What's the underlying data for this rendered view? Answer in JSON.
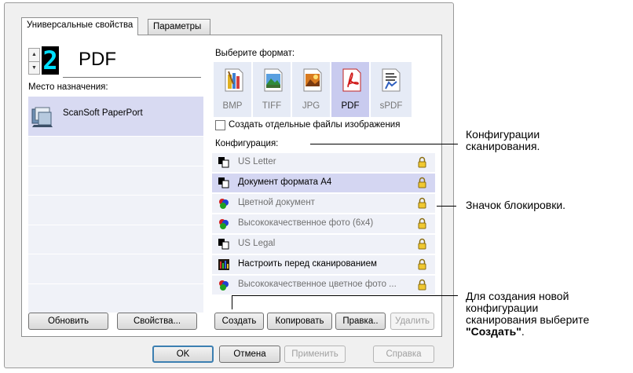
{
  "tabs": {
    "universal": "Универсальные свойства",
    "params": "Параметры"
  },
  "format_display": {
    "number": "2",
    "name": "PDF"
  },
  "destination": {
    "label": "Место назначения:",
    "items": [
      "ScanSoft PaperPort"
    ]
  },
  "format_select": {
    "label": "Выберите формат:",
    "formats": [
      "BMP",
      "TIFF",
      "JPG",
      "PDF",
      "sPDF"
    ],
    "selected": "PDF"
  },
  "separate_files": {
    "label": "Создать отдельные файлы изображения",
    "checked": false
  },
  "configuration": {
    "label": "Конфигурация:",
    "items": [
      "US Letter",
      "Документ формата А4",
      "Цветной документ",
      "Высококачественное фото (6x4)",
      "US Legal",
      "Настроить перед сканированием",
      "Высококачественное цветное фото ..."
    ],
    "selected": "Документ формата А4"
  },
  "buttons": {
    "refresh": "Обновить",
    "properties": "Свойства...",
    "create": "Создать",
    "copy": "Копировать",
    "edit": "Правка..",
    "delete": "Удалить",
    "ok": "OK",
    "cancel": "Отмена",
    "apply": "Применить",
    "help": "Справка"
  },
  "callouts": {
    "configs": [
      "Конфигурации",
      "сканирования."
    ],
    "lock": "Значок блокировки.",
    "create_1": "Для создания новой",
    "create_2": "конфигурации",
    "create_3": "сканирования выберите",
    "create_4": "\"Создать\"",
    "create_5": "."
  },
  "colors": {
    "lcd": "#00e0ff",
    "selection": "#d4d6f2",
    "accent": "#3c7fb1"
  }
}
